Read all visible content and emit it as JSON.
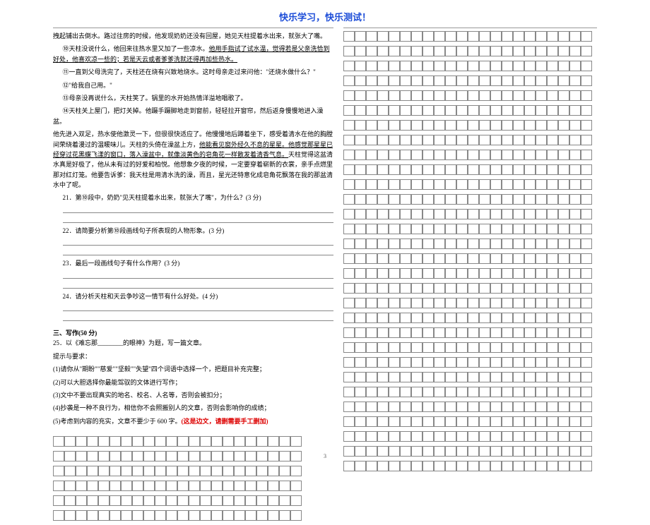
{
  "header": "快乐学习，快乐测试！",
  "passage": {
    "p_intro": "拽起铺出去倒水。路过往房的时候，他发现奶奶还没有回屋，她见天柱提着水出来，就张大了嘴。",
    "p10a": "⑩天柱没说什么，他回来往热水里又加了一些凉水。",
    "p10u": "他用手指试了试水温，觉得若是父亲洗恰到好处，他喜欢凉一些的；若是天云或者爹爹洗就还得再加些热水。",
    "p11": "⑪一直到父母洗完了，天柱还在烧有兴致地烧水。这时母亲走过来问他：\"还烧水做什么？\"",
    "p12": "⑫\"给我自己用。\"",
    "p13": "⑬母亲没再说什么，天柱笑了。锅里的水开始热情洋溢地唱歌了。",
    "p14": "⑭天柱关上屋门，把灯关掉。他蹑手蹑脚地走到窗前，轻轻拉开窗帘，然后返身慢慢地进入澡盆。",
    "p_after1": "他先进入双足，热水使他激灵一下，但很很快适应了。他慢慢地后蹲着坐下，感受着清水在他的胸膛间荣绕着漫过的温暖味儿。天柱的头倚在澡盆上方，",
    "p_after1u": "他能看见窗外经久不息的星星。他感觉那星星已经穿过花黑蝶飞漾的窗口，落入澡盆中，就像淡黄色的皂角花一样散发着清香气息。",
    "p_after2": "天柱觉得这盆清水真是好极了，他从未有过的好爱和柏悦。他想象夕夜的时候，一定要穿着崭新的衣裳，亲手点燃里那对红灯笼。他要告诉爹：我天柱是用清水洗的澡，而且，星光还特意化成皂角花飘落在我的那盆清水中了呢。"
  },
  "q21": "21．第⑩段中，奶奶\"见天柱提着水出来，就张大了嘴\"，为什么？(3 分)",
  "q22": "22．请简要分析第⑩段画线句子所表现的人物形象。(3 分)",
  "q23": "23．最后一段画线句子有什么作用？(3 分)",
  "q24": "24．请分析天柱和天云争吵这一情节有什么好处。(4 分)",
  "writing": {
    "title": "三、写作(50 分)",
    "q25a": "25．以《难忘那________的眼神》为题，写一篇文章。",
    "hint_label": "提示与要求：",
    "h1": "(1)请你从\"期盼\"\"慈爱\"\"坚毅\"\"失望\"四个词语中选择一个，把题目补充完整；",
    "h2": "(2)可以大胆选择你最能驾驭的文体进行写作；",
    "h3": "(3)文中不要出现真实的地名、校名、人名等，否则会被扣分；",
    "h4": "(4)抄袭是一种不良行为，相信你不会照搬别人的文章，否则会影响你的成绩；",
    "h5a": "(5)考虑到内容的充实，文章不要少于 600 字。",
    "h5red": "(这是边文，请删需要手工删加)"
  },
  "page_num": "3",
  "grid": {
    "cols": 22,
    "right_rows": 30,
    "left_rows": 6
  }
}
